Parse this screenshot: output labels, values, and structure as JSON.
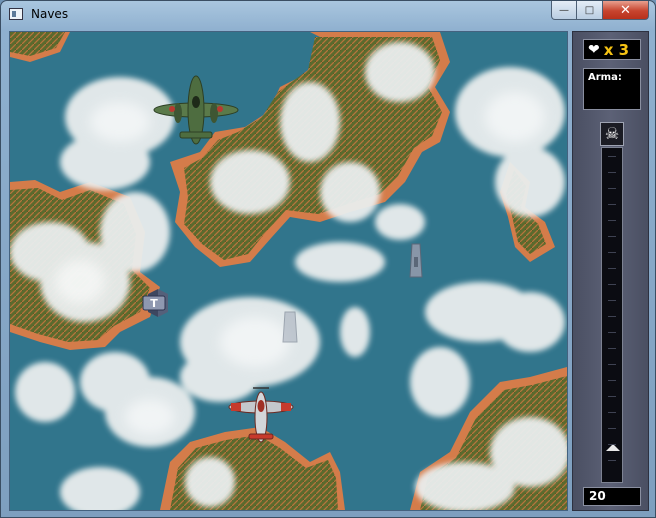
{
  "window": {
    "title": "Naves",
    "buttons": {
      "minimize": "—",
      "maximize": "□",
      "close": "✕"
    }
  },
  "hud": {
    "lives_icon": "heart-icon",
    "lives_text": "x 3",
    "weapon_label": "Arma:",
    "weapon_value": "",
    "progress_icon": "skull-icon",
    "progress_fraction": 0.08,
    "score": "20"
  },
  "game": {
    "player": "red-fighter-plane",
    "enemy": "green-bomber-plane",
    "pickup_letter": "T",
    "boats": 2
  },
  "colors": {
    "sea": "#2b6f87",
    "land": "#5e6b2e",
    "shore": "#d47c4a",
    "cloud": "#e9ecec",
    "accent": "#f5c214"
  }
}
